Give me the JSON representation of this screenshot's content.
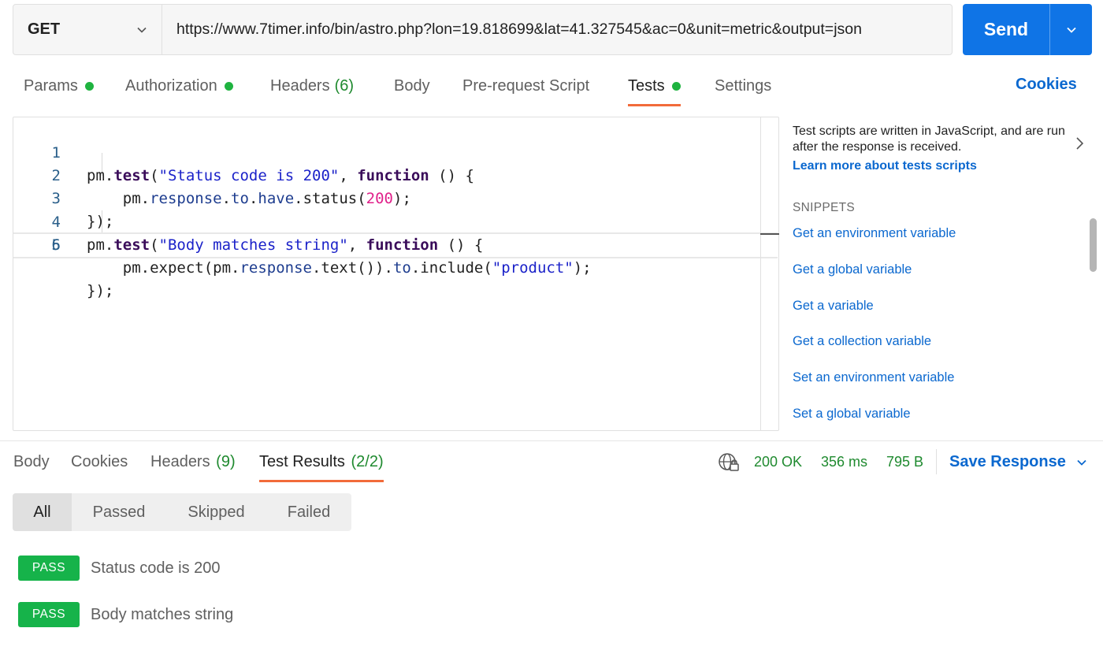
{
  "request": {
    "method": "GET",
    "url": "https://www.7timer.info/bin/astro.php?lon=19.818699&lat=41.327545&ac=0&unit=metric&output=json",
    "send_label": "Send"
  },
  "request_tabs": {
    "params": "Params",
    "authorization": "Authorization",
    "headers": "Headers",
    "headers_count": "(6)",
    "body": "Body",
    "prerequest": "Pre-request Script",
    "tests": "Tests",
    "settings": "Settings",
    "cookies": "Cookies",
    "active": "Tests"
  },
  "editor": {
    "line_numbers": [
      "1",
      "2",
      "3",
      "4",
      "5",
      "6"
    ]
  },
  "sidebar": {
    "help_text": "Test scripts are written in JavaScript, and are run after the response is received.",
    "help_link": "Learn more about tests scripts",
    "snippets_heading": "SNIPPETS",
    "snippets": [
      "Get an environment variable",
      "Get a global variable",
      "Get a variable",
      "Get a collection variable",
      "Set an environment variable",
      "Set a global variable"
    ]
  },
  "response_tabs": {
    "body": "Body",
    "cookies": "Cookies",
    "headers": "Headers",
    "headers_count": "(9)",
    "test_results": "Test Results",
    "test_results_count": "(2/2)"
  },
  "response_status": {
    "status": "200 OK",
    "time": "356 ms",
    "size": "795 B",
    "save_label": "Save Response"
  },
  "filters": [
    "All",
    "Passed",
    "Skipped",
    "Failed"
  ],
  "results": [
    {
      "badge": "PASS",
      "name": "Status code is 200"
    },
    {
      "badge": "PASS",
      "name": "Body matches string"
    }
  ],
  "colors": {
    "accent_blue": "#0f74e6",
    "link_blue": "#0b68cf",
    "status_green": "#1fb340",
    "tab_underline": "#f26b3a"
  }
}
